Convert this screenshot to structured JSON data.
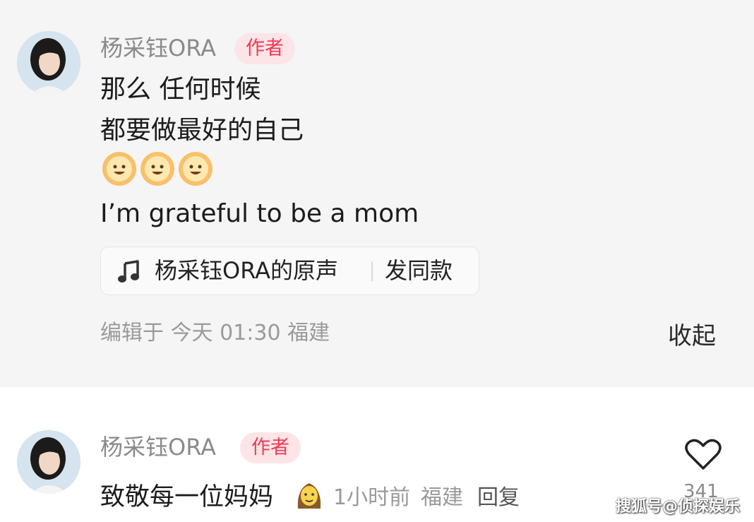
{
  "comments": [
    {
      "username": "杨采钰ORA",
      "badge": "作者",
      "lines": [
        "那么 任何时候",
        "都要做最好的自己",
        "I’m grateful to be a mom"
      ],
      "emoji": [
        "sun-face-emoji",
        "sun-face-emoji",
        "sun-face-emoji"
      ],
      "music": {
        "icon": "music-note-icon",
        "title": "杨采钰ORA的原声",
        "action": "发同款"
      },
      "meta": "编辑于 今天 01:30 福建",
      "collapse_label": "收起"
    },
    {
      "username": "杨采钰ORA",
      "badge": "作者",
      "text": "致敬每一位妈妈",
      "emoji": "woman-emoji",
      "time": "1小时前",
      "location": "福建",
      "reply_label": "回复",
      "like_icon": "heart-icon",
      "like_count": "341"
    }
  ],
  "watermark": "搜狐号@侦探娱乐",
  "colors": {
    "badge_text": "#ee3b54",
    "badge_bg": "#fde4e6",
    "meta_text": "#9a9a9a",
    "card_bg": "#f5f5f5"
  }
}
